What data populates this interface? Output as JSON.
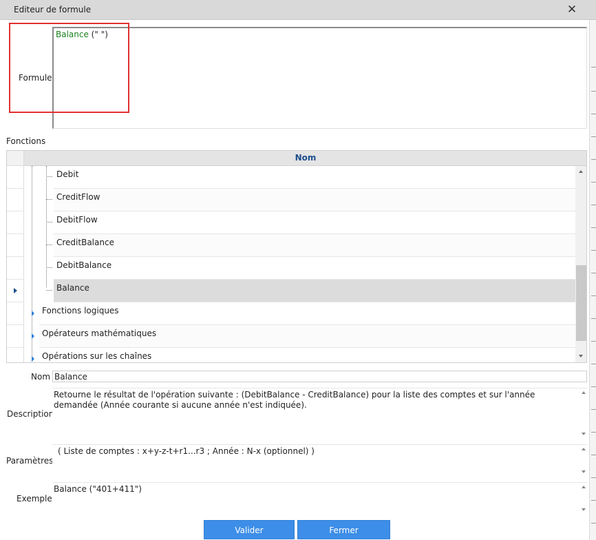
{
  "window": {
    "title": "Editeur de formule",
    "close_glyph": "✕"
  },
  "formula": {
    "label": "Formule",
    "function_name": "Balance",
    "arguments": " (\" \")"
  },
  "functions": {
    "label": "Fonctions",
    "column_header": "Nom",
    "rows": [
      {
        "label": "Debit",
        "level": 2,
        "selected": false
      },
      {
        "label": "CreditFlow",
        "level": 2,
        "selected": false
      },
      {
        "label": "DebitFlow",
        "level": 2,
        "selected": false
      },
      {
        "label": "CreditBalance",
        "level": 2,
        "selected": false
      },
      {
        "label": "DebitBalance",
        "level": 2,
        "selected": false
      },
      {
        "label": "Balance",
        "level": 2,
        "selected": true
      },
      {
        "label": "Fonctions logiques",
        "level": 1,
        "selected": false
      },
      {
        "label": "Opérateurs mathématiques",
        "level": 1,
        "selected": false
      },
      {
        "label": "Opérations sur les chaînes",
        "level": 1,
        "selected": false
      }
    ]
  },
  "details": {
    "name_label": "Nom",
    "name_value": "Balance",
    "description_label": "Description",
    "description_value": "Retourne le résultat de l'opération suivante : (DebitBalance - CreditBalance) pour la liste des comptes et sur l'année demandée (Année courante si aucune année n'est indiquée).",
    "params_label": "Paramètres",
    "params_value": "( Liste de comptes : x+y-z-t+r1...r3 ; Année : N-x (optionnel) )",
    "example_label": "Exemple",
    "example_value": "Balance (\"401+411\")"
  },
  "buttons": {
    "validate": "Valider",
    "close": "Fermer"
  },
  "colors": {
    "accent": "#3d8ee8",
    "header_text": "#1e4f8c",
    "function_name": "#1a7f1a",
    "highlight_border": "#e03030"
  }
}
